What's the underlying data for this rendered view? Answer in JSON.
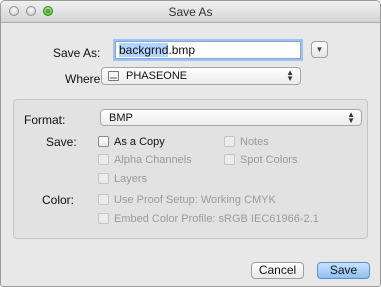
{
  "window": {
    "title": "Save As"
  },
  "save_as": {
    "label": "Save As:",
    "filename_selected": "backgrnd",
    "filename_rest": ".bmp"
  },
  "where": {
    "label": "Where:",
    "value": "PHASEONE"
  },
  "format": {
    "label": "Format:",
    "value": "BMP"
  },
  "save_options": {
    "label": "Save:",
    "as_a_copy": {
      "label": "As a Copy",
      "checked": false,
      "enabled": true
    },
    "notes": {
      "label": "Notes",
      "checked": false,
      "enabled": false
    },
    "alpha_channels": {
      "label": "Alpha Channels",
      "checked": false,
      "enabled": false
    },
    "spot_colors": {
      "label": "Spot Colors",
      "checked": false,
      "enabled": false
    },
    "layers": {
      "label": "Layers",
      "checked": false,
      "enabled": false
    }
  },
  "color_options": {
    "label": "Color:",
    "use_proof_setup": {
      "label": "Use Proof Setup:  Working CMYK",
      "checked": false,
      "enabled": false
    },
    "embed_color_profile": {
      "label": "Embed Color Profile:  sRGB IEC61966-2.1",
      "checked": false,
      "enabled": false
    }
  },
  "buttons": {
    "cancel": "Cancel",
    "save": "Save"
  },
  "colors": {
    "accent": "#8fc0f2",
    "focus_ring": "#9fc2f0",
    "selection": "#b3d4fd",
    "zoom_light": "#35b021"
  }
}
